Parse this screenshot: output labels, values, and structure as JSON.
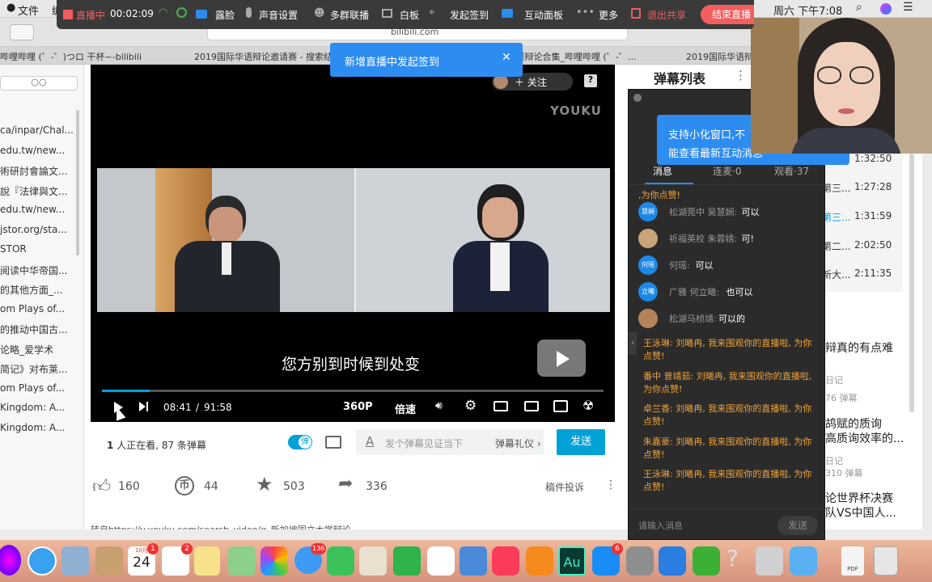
{
  "mac_menu": {
    "file": "文件",
    "next": "编",
    "right_time": "周六 下午7:08"
  },
  "live_bar": {
    "status": "直播中",
    "timer": "00:02:09",
    "items": [
      "露脸",
      "声音设置",
      "多群联播",
      "白板",
      "发起签到",
      "互动面板",
      "更多"
    ],
    "exit_share": "退出共享",
    "end_live": "结束直播"
  },
  "browser": {
    "url": "bilibili.com",
    "tabs": [
      "哔哩哔哩 (゜-゜)つロ 干杯~-bilibili",
      "2019国际华语辩论邀请赛 - 搜索结果",
      "…请赛 庞颖辩论合集_哔哩哔哩 (゜-゜…",
      "2019国际华语辩"
    ]
  },
  "toast": {
    "text": "新增直播中发起签到"
  },
  "left_list": [
    "ca/inpar/Chal...",
    "edu.tw/new...",
    "術研討會論文...",
    "說『法律與文...",
    "edu.tw/new...",
    "jstor.org/sta...",
    "STOR",
    "阅读中华帝国...",
    "的其他方面_...",
    "om Plays of...",
    "的推动中国古...",
    "论略_爱学术",
    "简记》对布莱...",
    "om Plays of...",
    "Kingdom: A...",
    "Kingdom: A..."
  ],
  "video": {
    "follow": "关注",
    "watermark": "YOUKU",
    "subtitle": "您方别到时候到处变",
    "time_current": "08:41",
    "time_total": "91:58",
    "time_sep": "/",
    "quality": "360P",
    "speed": "倍速",
    "progress": 0.095
  },
  "below_video": {
    "viewers": "1",
    "viewers_text": "人正在看,",
    "danmaku_count": "87",
    "danmaku_text": "条弹幕",
    "toggle_label": "弹",
    "input_placeholder": "发个弹幕见证当下",
    "etiquette": "弹幕礼仪",
    "send": "发送"
  },
  "stats": {
    "likes": "160",
    "coins": "44",
    "favorites": "503",
    "shares": "336",
    "report": "稿件投诉"
  },
  "desc": "转自https://v.youku.com/search_video/q_新加坡国立大学辩论",
  "right_col": {
    "title": "弹幕列表",
    "times": [
      "1:32:50",
      "1:27:28",
      "1:31:59",
      "2:02:50",
      "2:11:35"
    ],
    "partials": [
      "第三...",
      "第三...",
      "第二...",
      "新大..."
    ],
    "rec1_title": "辩真的有点难",
    "rec1_sub": "日记",
    "rec1_count": "76 弹幕",
    "rec2_title1": "鸪赋的质询",
    "rec2_title2": "高质询效率的...",
    "rec2_sub": "日记",
    "rec2_count": "310 弹幕",
    "rec3_title1": "论世界杯决赛",
    "rec3_title2": "队VS中国人..."
  },
  "chat": {
    "tooltip1": "支持小化窗口,不",
    "tooltip2": "能查看最新互动消息",
    "tabs": [
      "消息",
      "连麦·0",
      "观看·37"
    ],
    "top_partial": ",为你点赞!",
    "messages": [
      {
        "avatar": "慧娴",
        "user": "松湖莞中 吴慧娴:",
        "text": "可以",
        "color": "#1e88e5"
      },
      {
        "avatar": "",
        "user": "祈福英校 朱蓉婧:",
        "text": "可!",
        "color": "#c9a37a"
      },
      {
        "avatar": "何瑶",
        "user": "何瑶:",
        "text": "可以",
        "color": "#1e88e5"
      },
      {
        "avatar": "立曦",
        "user": "广雅 何立曦:",
        "text": "也可以",
        "color": "#1e88e5"
      },
      {
        "avatar": "",
        "user": "松湖马桢靖:",
        "text": "可以的",
        "color": "#b5835a"
      }
    ],
    "orange": [
      "王泳琳: 刘曦冉, 我来围观你的直播啦, 为你点赞!",
      "番中 曾靖茹: 刘曦冉, 我来围观你的直播啦, 为你点赞!",
      "卓兰香: 刘曦冉, 我来围观你的直播啦, 为你点赞!",
      "朱嘉豪: 刘曦冉, 我来围观你的直播啦, 为你点赞!",
      "王泳琳: 刘曦冉, 我来围观你的直播啦, 为你点赞!"
    ],
    "input_placeholder": "请输入消息",
    "send": "发送"
  },
  "dock": {
    "calendar_month": "10月",
    "calendar_day": "24",
    "badge_cal": "1",
    "badge_rem": "2",
    "badge_msg": "136",
    "badge_store": "6",
    "ae_label": "Au",
    "pdf": "PDF"
  },
  "colors": {
    "accent": "#00a1d6",
    "live_red": "#f25d5d",
    "chat_orange": "#f0a33a",
    "toast": "#2d8cf0"
  }
}
